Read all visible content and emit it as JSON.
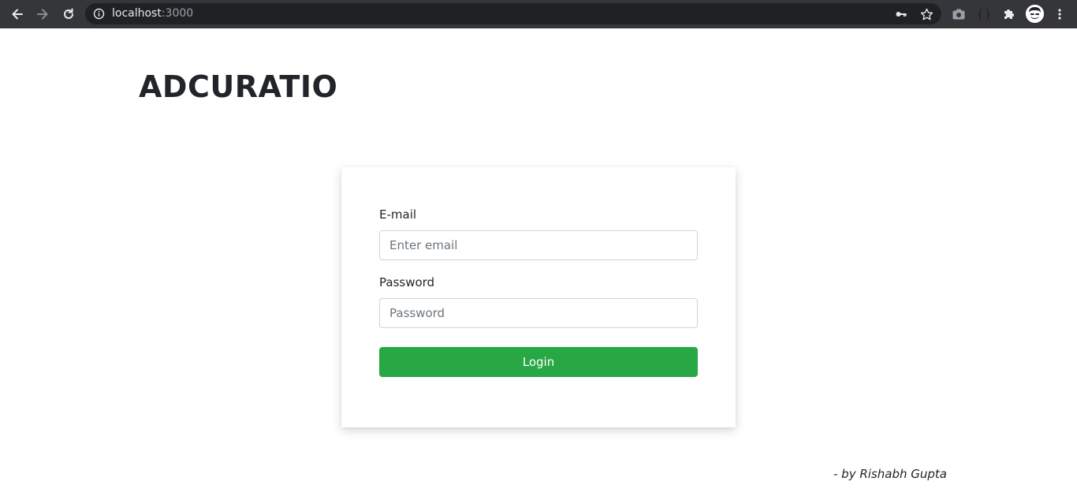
{
  "browser": {
    "url_host": "localhost",
    "url_port": ":3000",
    "icons": {
      "back": "back-arrow-icon",
      "forward": "forward-arrow-icon",
      "reload": "reload-icon",
      "info": "info-icon",
      "key": "key-icon",
      "bookmark": "star-icon",
      "screenshot": "camera-icon",
      "devtools": "braces-icon",
      "extensions": "puzzle-icon",
      "profile": "avatar",
      "menu": "kebab-menu-icon"
    }
  },
  "header": {
    "brand": "ADCURATIO"
  },
  "login_form": {
    "email_label": "E-mail",
    "email_placeholder": "Enter email",
    "email_value": "",
    "password_label": "Password",
    "password_placeholder": "Password",
    "password_value": "",
    "submit_label": "Login"
  },
  "footer": {
    "credit": "- by Rishabh Gupta"
  },
  "colors": {
    "chrome_bg": "#35363a",
    "omnibox_bg": "#202124",
    "primary_button": "#28a745",
    "text": "#212529",
    "input_border": "#ced4da"
  }
}
